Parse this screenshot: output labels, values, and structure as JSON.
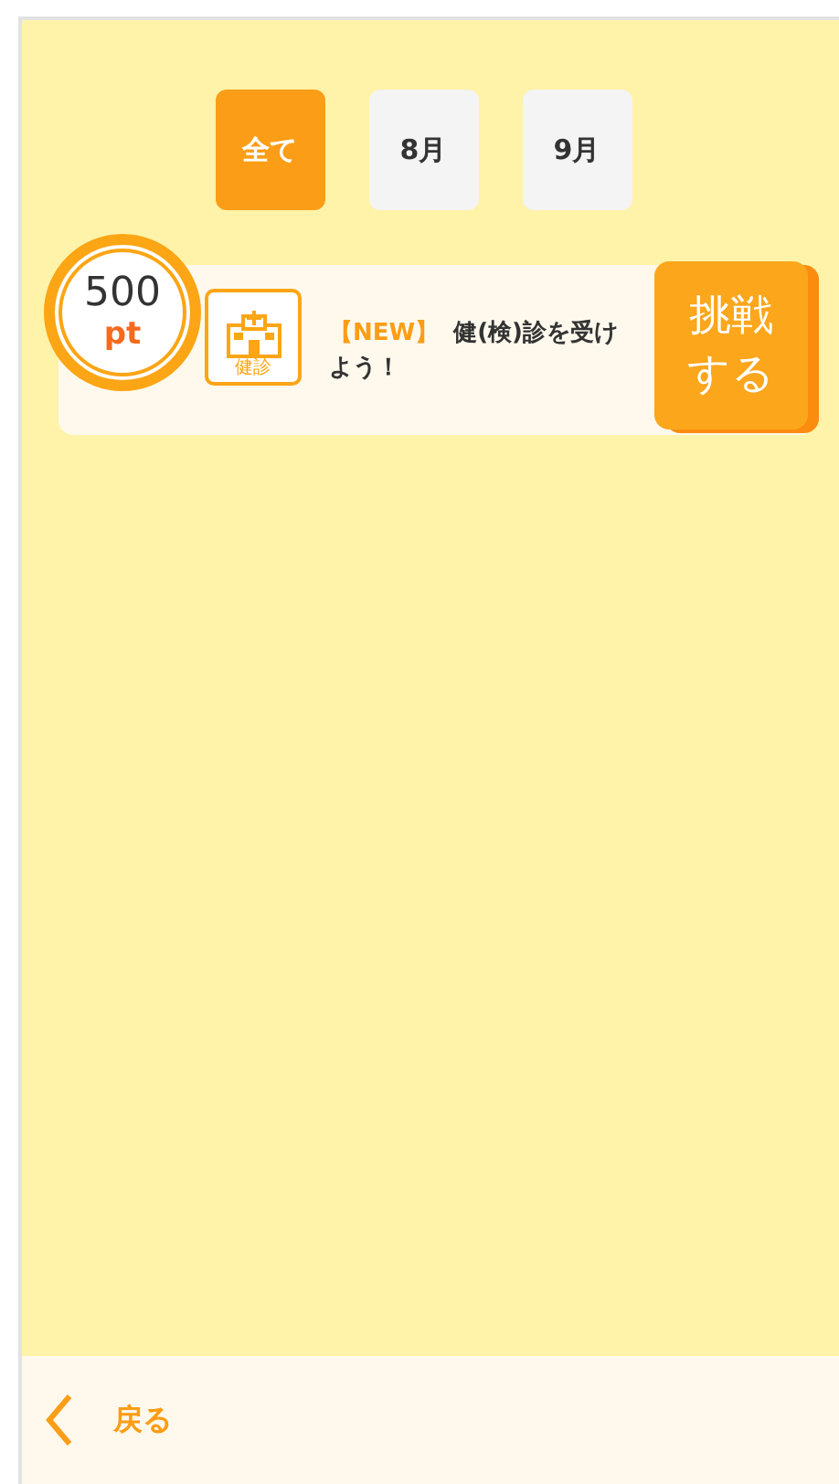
{
  "tabs": [
    {
      "label": "全て",
      "selected": true
    },
    {
      "label": "8月",
      "selected": false
    },
    {
      "label": "9月",
      "selected": false
    }
  ],
  "challenges": [
    {
      "points": "500",
      "unit": "pt",
      "icon_label": "健診",
      "tag": "【NEW】",
      "title": "健(検)診を受けよう！",
      "action": "挑戦する"
    }
  ],
  "footer": {
    "back": "戻る"
  }
}
